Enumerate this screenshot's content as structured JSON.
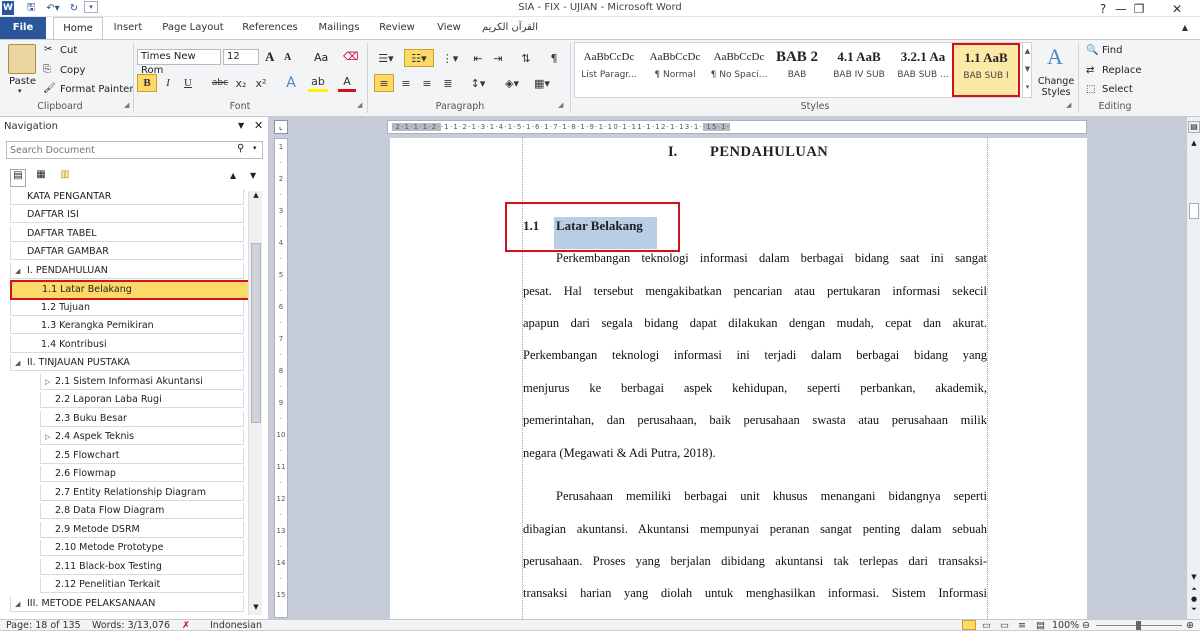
{
  "window": {
    "title": "SIA - FIX - UJIAN  -  Microsoft Word"
  },
  "tabs": [
    "File",
    "Home",
    "Insert",
    "Page Layout",
    "References",
    "Mailings",
    "Review",
    "View",
    "القرآن الكريم"
  ],
  "clipboard": {
    "paste": "Paste",
    "cut": "Cut",
    "copy": "Copy",
    "format_painter": "Format Painter",
    "group": "Clipboard"
  },
  "font": {
    "name": "Times New Rom",
    "size": "12",
    "group": "Font",
    "bold": "B",
    "italic": "I",
    "underline": "U",
    "strike": "abc",
    "sub": "x₂",
    "sup": "x²",
    "grow": "A",
    "shrink": "A",
    "case": "Aa",
    "color": "A"
  },
  "paragraph": {
    "group": "Paragraph"
  },
  "styles": {
    "group": "Styles",
    "items": [
      {
        "sample": "AaBbCcDc",
        "name": "List Paragr..."
      },
      {
        "sample": "AaBbCcDc",
        "name": "¶ Normal"
      },
      {
        "sample": "AaBbCcDc",
        "name": "¶ No Spaci..."
      },
      {
        "sample": "BAB 2",
        "name": "BAB"
      },
      {
        "sample": "4.1  AaB",
        "name": "BAB IV SUB"
      },
      {
        "sample": "3.2.1  Aa",
        "name": "BAB SUB ..."
      },
      {
        "sample": "1.1  AaB",
        "name": "BAB SUB I"
      }
    ],
    "change": "Change Styles"
  },
  "editing": {
    "group": "Editing",
    "find": "Find",
    "replace": "Replace",
    "select": "Select"
  },
  "navigation": {
    "title": "Navigation",
    "search_placeholder": "Search Document",
    "items": [
      {
        "label": "KATA PENGANTAR",
        "level": 1
      },
      {
        "label": "DAFTAR ISI",
        "level": 1
      },
      {
        "label": "DAFTAR TABEL",
        "level": 1
      },
      {
        "label": "DAFTAR GAMBAR",
        "level": 1
      },
      {
        "label": "I. PENDAHULUAN",
        "level": 1,
        "expanded": true
      },
      {
        "label": "1.1 Latar Belakang",
        "level": 2,
        "selected": true
      },
      {
        "label": "1.2 Tujuan",
        "level": 2
      },
      {
        "label": "1.3 Kerangka Pemikiran",
        "level": 2
      },
      {
        "label": "1.4 Kontribusi",
        "level": 2
      },
      {
        "label": "II. TINJAUAN PUSTAKA",
        "level": 1,
        "expanded": true
      },
      {
        "label": "2.1 Sistem Informasi Akuntansi",
        "level": 3,
        "collapsed": true
      },
      {
        "label": "2.2 Laporan Laba Rugi",
        "level": 3
      },
      {
        "label": "2.3 Buku Besar",
        "level": 3
      },
      {
        "label": "2.4 Aspek Teknis",
        "level": 3,
        "collapsed": true
      },
      {
        "label": "2.5 Flowchart",
        "level": 3
      },
      {
        "label": "2.6 Flowmap",
        "level": 3
      },
      {
        "label": "2.7 Entity Relationship Diagram",
        "level": 3
      },
      {
        "label": "2.8 Data Flow Diagram",
        "level": 3
      },
      {
        "label": "2.9 Metode DSRM",
        "level": 3
      },
      {
        "label": "2.10 Metode Prototype",
        "level": 3
      },
      {
        "label": "2.11 Black-box Testing",
        "level": 3
      },
      {
        "label": "2.12 Penelitian Terkait",
        "level": 3
      },
      {
        "label": "III. METODE PELAKSANAAN",
        "level": 1,
        "expanded": true
      }
    ]
  },
  "document": {
    "heading_num": "I.",
    "heading": "PENDAHULUAN",
    "sub_num": "1.1",
    "sub_title": "Latar Belakang",
    "lines": [
      "Perkembangan teknologi informasi dalam berbagai bidang saat ini sangat",
      "pesat. Hal tersebut mengakibatkan pencarian atau pertukaran informasi sekecil",
      "apapun dari segala bidang dapat dilakukan dengan mudah, cepat dan  akurat.",
      "Perkembangan teknologi informasi ini terjadi dalam berbagai bidang yang",
      "menjurus ke berbagai aspek kehidupan, seperti perbankan, akademik,",
      "pemerintahan,  dan  perusahaan, baik perusahaan swasta atau perusahaan milik",
      "negara (Megawati & Adi Putra, 2018).",
      "Perusahaan memiliki berbagai unit khusus menangani bidangnya seperti",
      "dibagian akuntansi. Akuntansi mempunyai peranan sangat penting dalam sebuah",
      "perusahaan. Proses yang berjalan dibidang akuntansi tak terlepas dari transaksi-",
      "transaksi harian yang diolah untuk menghasilkan informasi. Sistem Informasi"
    ]
  },
  "status": {
    "page": "Page: 18 of 135",
    "words": "Words: 3/13,076",
    "language": "Indonesian",
    "zoom": "100%"
  },
  "colors": {
    "accent": "#2b579a",
    "highlight": "#b9cde5",
    "selected_nav": "#fcd968",
    "red_box": "#d0121b"
  }
}
